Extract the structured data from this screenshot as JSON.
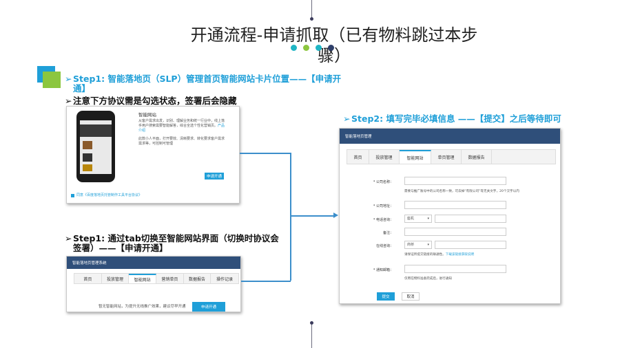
{
  "title": {
    "line1": "开通流程-申请抓取（已有物料跳过本步",
    "line2": "骤）"
  },
  "steps": {
    "step1a_line1": "Step1: 智能落地页（SLP）管理首页智能网站卡片位置——【申请开",
    "step1a_line2": "通】",
    "note": "注意下方协议需是勾选状态，签署后会隐藏",
    "step1b_line1": "Step1: 通过tab切换至智能网站界面（切换时协议会",
    "step1b_line2": "签署）——【申请开通】",
    "step2": "Step2: 填写完毕必填信息 ——【提交】之后等待即可"
  },
  "card": {
    "title": "智能网站",
    "desc1": "从客户需求出发，识别、理解业务和统一行业中，线上落手用户搜索需要智能解答，综合全选个性化营销页。",
    "desc1_link": "产品介绍",
    "desc2": "此款小人平面，打开要效、清晰要求、转化要求客户需求需求等，可控制可管理",
    "apply_button": "申请开通",
    "agree_text": "同意《百度落地页托管制作工具平台协议》"
  },
  "shot_tabs": {
    "header": "智能落地页管理系统",
    "tabs": [
      "首页",
      "投放管理",
      "智能网站",
      "营销单页",
      "数据报告",
      "操作记录"
    ],
    "message": "暂无智能网站，为提升无线推广效果，建议尽早开通",
    "apply_button": "申请开通"
  },
  "form": {
    "header": "智能落地页管理",
    "tabs": [
      "首页",
      "投放管理",
      "智能网站",
      "单页管理",
      "数据报告"
    ],
    "company_label": "* 公司名称：",
    "company_hint": "需要与推广账号中的公司名称一致，可去掉“有限公司”等无关文字，20个汉字以内",
    "address_label": "* 公司地址：",
    "phone_label": "* 电话咨询：",
    "phone_select": "座机",
    "note_label": "备注：",
    "online_label": "在线咨询：",
    "online_select": "商桥",
    "online_hint": "请保证所提交链接的联通性。",
    "online_link": "下载该链接获取说明",
    "email_label": "* 通知邮箱：",
    "email_hint": "仅用在物料准备完成后，进行通知",
    "submit": "提交",
    "cancel": "取消"
  },
  "colors": {
    "accent": "#1f9fd8",
    "green": "#8cc63f",
    "header": "#2f4f7a"
  }
}
